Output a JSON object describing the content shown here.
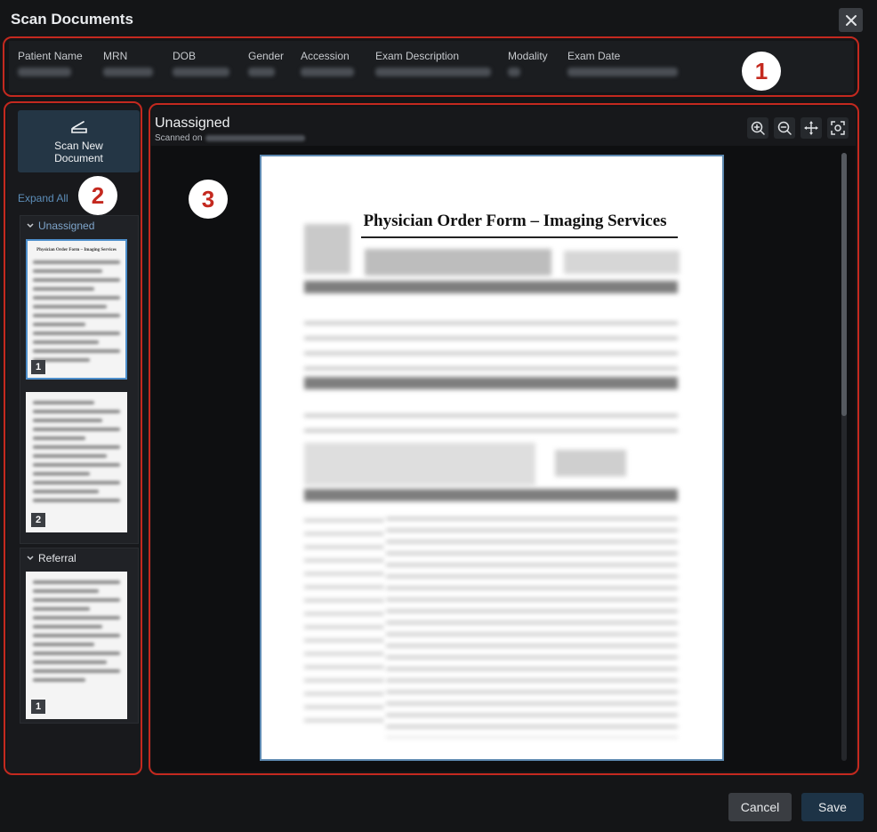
{
  "window": {
    "title": "Scan Documents"
  },
  "header": {
    "columns": [
      {
        "label": "Patient Name"
      },
      {
        "label": "MRN"
      },
      {
        "label": "DOB"
      },
      {
        "label": "Gender"
      },
      {
        "label": "Accession"
      },
      {
        "label": "Exam Description"
      },
      {
        "label": "Modality"
      },
      {
        "label": "Exam Date"
      }
    ]
  },
  "left_panel": {
    "scan_button_label": "Scan New\nDocument",
    "scan_line1": "Scan New",
    "scan_line2": "Document",
    "expand_all": "Expand All",
    "groups": [
      {
        "name": "Unassigned",
        "pages": [
          "1",
          "2"
        ],
        "selected_page": "1"
      },
      {
        "name": "Referral",
        "pages": [
          "1"
        ]
      }
    ]
  },
  "viewer": {
    "title": "Unassigned",
    "scanned_on_label": "Scanned on",
    "document_title": "Physician Order Form – Imaging Services",
    "thumb_title": "Physician Order Form – Imaging Services",
    "tools": [
      "zoom-in-icon",
      "zoom-out-icon",
      "pan-icon",
      "fit-to-screen-icon"
    ]
  },
  "annotations": {
    "badges": [
      "1",
      "2",
      "3"
    ],
    "color": "#c4291f"
  },
  "footer": {
    "cancel_label": "Cancel",
    "save_label": "Save"
  },
  "colors": {
    "accent": "#5c8db8",
    "save_button": "#1d3346",
    "selection_border": "#4e8fcc"
  }
}
